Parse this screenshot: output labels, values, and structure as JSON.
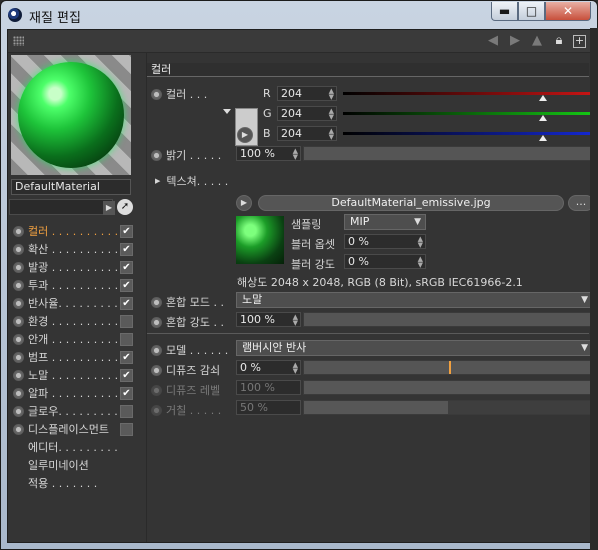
{
  "window": {
    "title": "재질 편집",
    "buttons": {
      "minimize": "▬",
      "maximize": "□",
      "close": "✕"
    }
  },
  "material": {
    "name": "DefaultMaterial"
  },
  "channels": [
    {
      "label": "컬러 . . . . . . . . . .",
      "checked": true,
      "active": true
    },
    {
      "label": "확산 . . . . . . . . . .",
      "checked": true,
      "active": false
    },
    {
      "label": "발광 . . . . . . . . . .",
      "checked": true,
      "active": false
    },
    {
      "label": "투과 . . . . . . . . . .",
      "checked": true,
      "active": false
    },
    {
      "label": "반사율. . . . . . . . .",
      "checked": true,
      "active": false
    },
    {
      "label": "환경 . . . . . . . . . .",
      "checked": false,
      "active": false
    },
    {
      "label": "안개 . . . . . . . . . .",
      "checked": false,
      "active": false
    },
    {
      "label": "범프 . . . . . . . . . .",
      "checked": true,
      "active": false
    },
    {
      "label": "노말 . . . . . . . . . .",
      "checked": true,
      "active": false
    },
    {
      "label": "알파 . . . . . . . . . .",
      "checked": true,
      "active": false
    },
    {
      "label": "글로우. . . . . . . . .",
      "checked": false,
      "active": false
    },
    {
      "label": "디스플레이스먼트",
      "checked": false,
      "active": false
    }
  ],
  "extra_items": [
    "에디터. . . . . . . . .",
    "일루미네이션",
    "적용 . . . . . . ."
  ],
  "color_section": {
    "header": "컬러",
    "color_label": "컬러 . . .",
    "r_label": "R",
    "g_label": "G",
    "b_label": "B",
    "r": "204",
    "g": "204",
    "b": "204",
    "r_fraction": 0.8,
    "g_fraction": 0.8,
    "b_fraction": 0.8,
    "brightness_label": "밝기 . . . . .",
    "brightness": "100 %",
    "brightness_fraction": 1.0,
    "texture_label": "텍스쳐. . . . .",
    "texture_file": "DefaultMaterial_emissive.jpg",
    "texture_more": "...",
    "sampling_label": "샘플링",
    "sampling": "MIP",
    "blur_offset_label": "블러 옵셋",
    "blur_offset": "0 %",
    "blur_strength_label": "블러 강도",
    "blur_strength": "0 %",
    "resolution_info": "해상도 2048 x 2048, RGB (8 Bit), sRGB IEC61966-2.1",
    "mix_mode_label": "혼합 모드 . .",
    "mix_mode": "노말",
    "mix_strength_label": "혼합 강도 . .",
    "mix_strength": "100 %",
    "mix_strength_fraction": 1.0
  },
  "model_section": {
    "model_label": "모델 . . . . . .",
    "model": "램버시안 반사",
    "diffuse_falloff_label": "디퓨즈 감쇠",
    "diffuse_falloff": "0 %",
    "diffuse_falloff_fraction": 0.5,
    "diffuse_level_label": "디퓨즈 레벨",
    "diffuse_level": "100 %",
    "diffuse_level_fraction": 1.0,
    "roughness_label": "거칠 . . . . .",
    "roughness": "50 %",
    "roughness_fraction": 0.5
  },
  "colors": {
    "accent": "#f0a040",
    "panel": "#343434",
    "r_line": "#c81414",
    "g_line": "#14c814",
    "b_line": "#1428d2"
  }
}
